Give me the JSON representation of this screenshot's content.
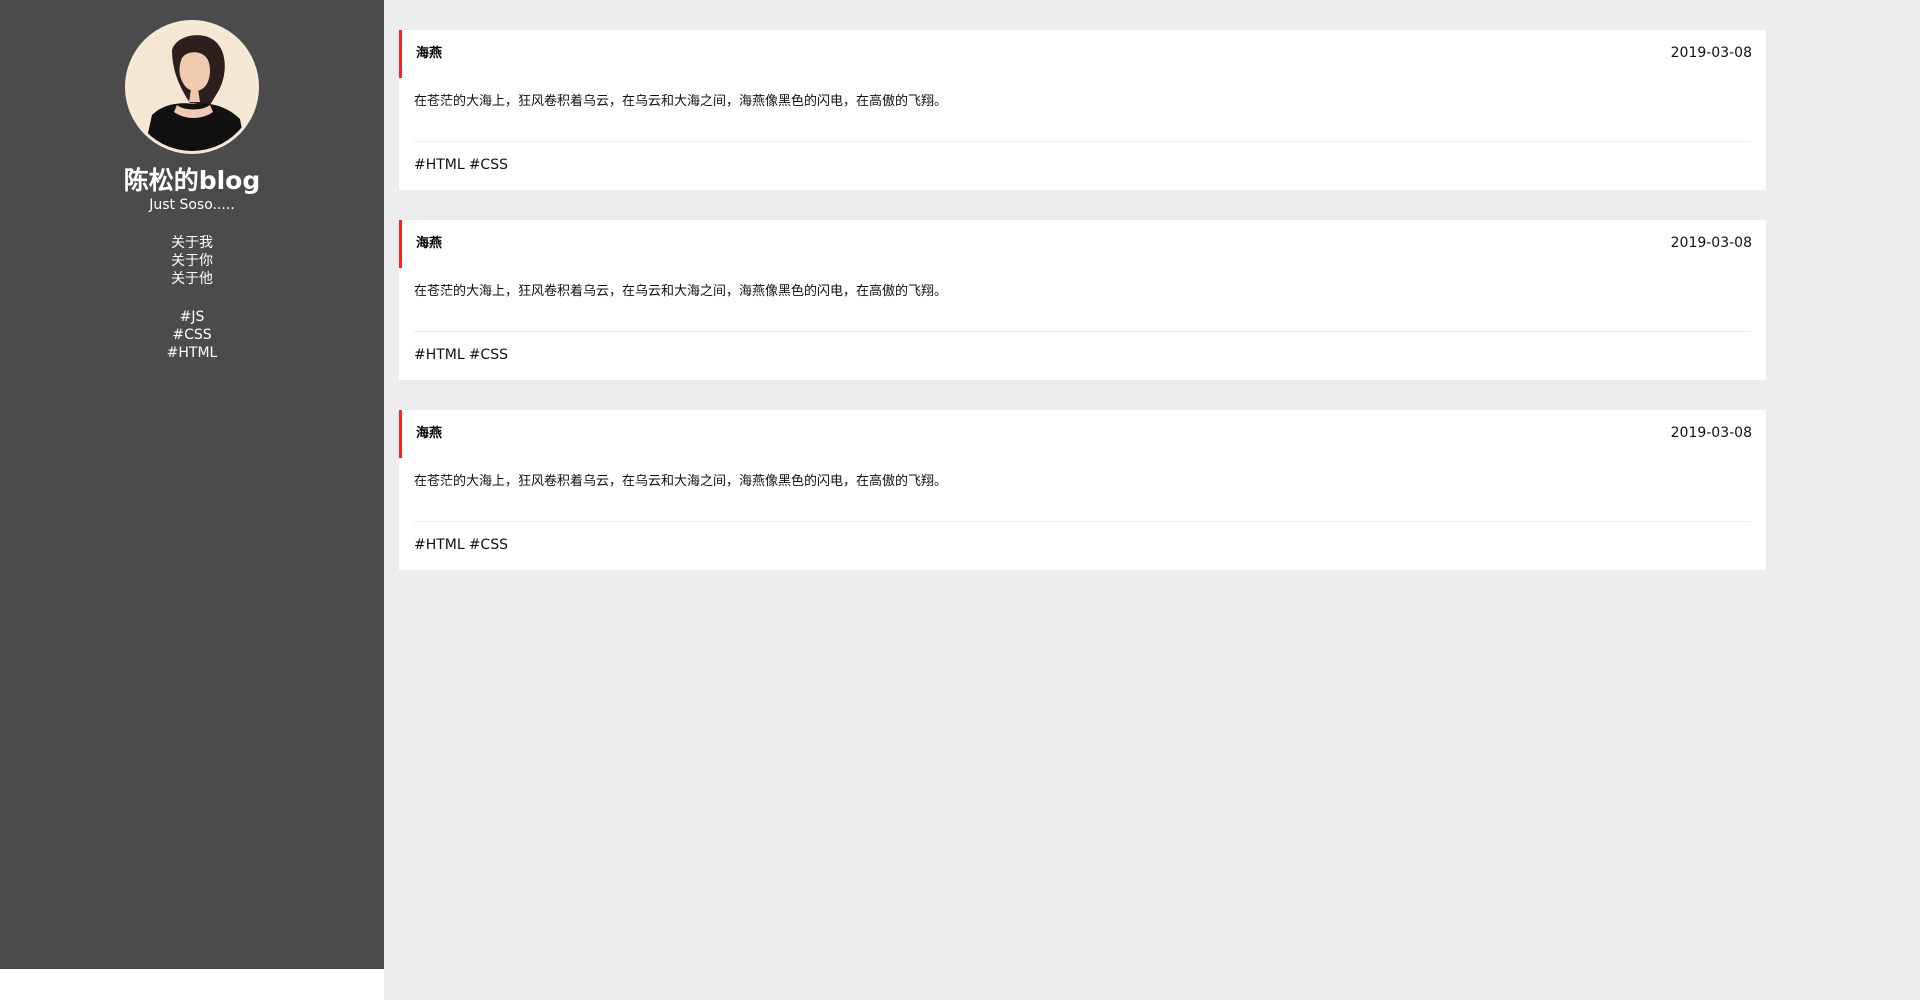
{
  "sidebar": {
    "title": "陈松的blog",
    "subtitle": "Just Soso.....",
    "nav": [
      {
        "label": "关于我"
      },
      {
        "label": "关于你"
      },
      {
        "label": "关于他"
      }
    ],
    "tags": [
      {
        "label": "#JS"
      },
      {
        "label": "#CSS"
      },
      {
        "label": "#HTML"
      }
    ]
  },
  "posts": [
    {
      "author": "海燕",
      "date": "2019-03-08",
      "body": "在苍茫的大海上，狂风卷积着乌云，在乌云和大海之间，海燕像黑色的闪电，在高傲的飞翔。",
      "tags": [
        "#HTML",
        "#CSS"
      ]
    },
    {
      "author": "海燕",
      "date": "2019-03-08",
      "body": "在苍茫的大海上，狂风卷积着乌云，在乌云和大海之间，海燕像黑色的闪电，在高傲的飞翔。",
      "tags": [
        "#HTML",
        "#CSS"
      ]
    },
    {
      "author": "海燕",
      "date": "2019-03-08",
      "body": "在苍茫的大海上，狂风卷积着乌云，在乌云和大海之间，海燕像黑色的闪电，在高傲的飞翔。",
      "tags": [
        "#HTML",
        "#CSS"
      ]
    }
  ],
  "colors": {
    "sidebar_bg": "#4b4b4b",
    "main_bg": "#ededed",
    "card_bg": "#ffffff",
    "accent": "#ff1f1f",
    "text": "#111111",
    "sidebar_text": "#ffffff"
  }
}
